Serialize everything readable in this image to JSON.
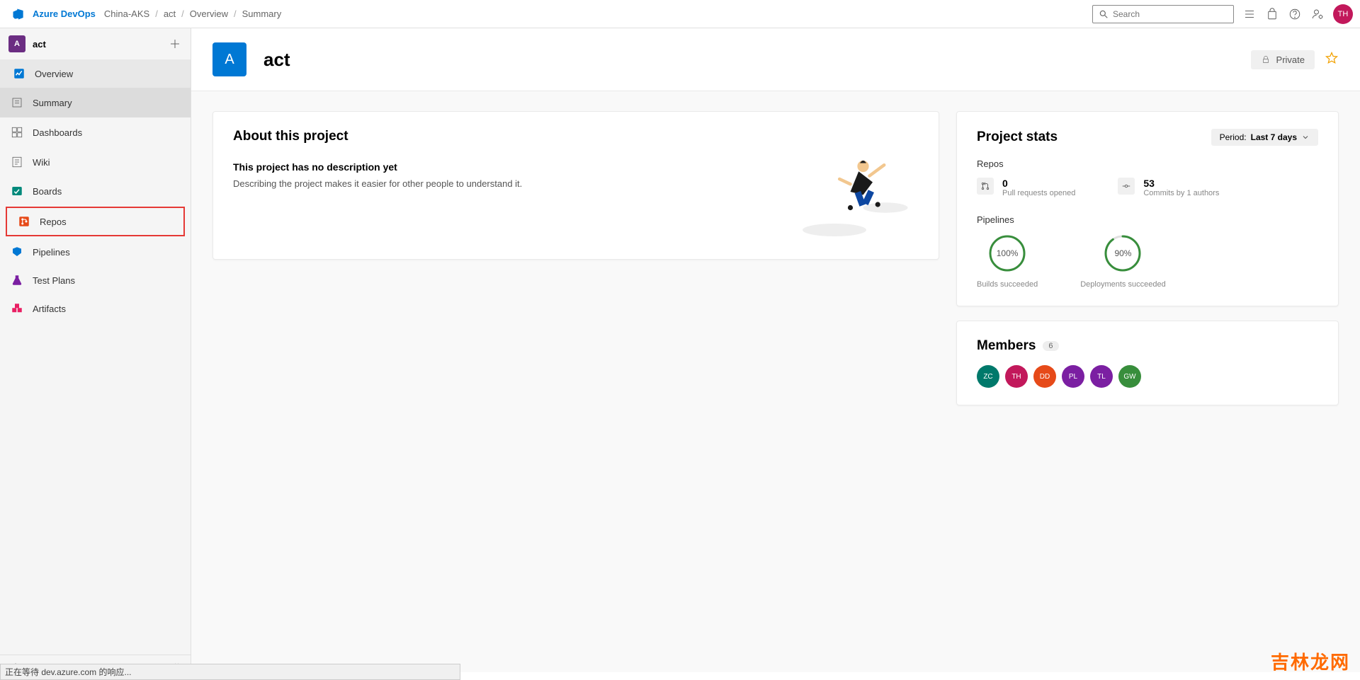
{
  "header": {
    "brand": "Azure DevOps",
    "breadcrumb": [
      "China-AKS",
      "act",
      "Overview",
      "Summary"
    ],
    "search_placeholder": "Search",
    "user_initials": "TH"
  },
  "sidebar": {
    "project_initial": "A",
    "project_name": "act",
    "items": [
      {
        "label": "Overview",
        "icon": "overview",
        "selected": true
      },
      {
        "label": "Summary",
        "icon": "summary",
        "sub": true,
        "active": true
      },
      {
        "label": "Dashboards",
        "icon": "dashboard",
        "sub": true
      },
      {
        "label": "Wiki",
        "icon": "wiki",
        "sub": true
      },
      {
        "label": "Boards",
        "icon": "boards"
      },
      {
        "label": "Repos",
        "icon": "repos",
        "highlighted": true
      },
      {
        "label": "Pipelines",
        "icon": "pipelines"
      },
      {
        "label": "Test Plans",
        "icon": "testplans"
      },
      {
        "label": "Artifacts",
        "icon": "artifacts"
      }
    ],
    "footer": "Project settings"
  },
  "content": {
    "project_initial": "A",
    "project_name": "act",
    "visibility": "Private",
    "about": {
      "title": "About this project",
      "subtitle": "This project has no description yet",
      "description": "Describing the project makes it easier for other people to understand it."
    },
    "stats": {
      "title": "Project stats",
      "period_label": "Period:",
      "period_value": "Last 7 days",
      "repos_label": "Repos",
      "pull_requests": {
        "value": "0",
        "label": "Pull requests opened"
      },
      "commits": {
        "value": "53",
        "label": "Commits by 1 authors"
      },
      "pipelines_label": "Pipelines",
      "builds": {
        "value": "100%",
        "label": "Builds succeeded",
        "percent": 100
      },
      "deployments": {
        "value": "90%",
        "label": "Deployments succeeded",
        "percent": 90
      }
    },
    "members": {
      "title": "Members",
      "count": "6",
      "list": [
        {
          "initials": "ZC",
          "color": "#00796b"
        },
        {
          "initials": "TH",
          "color": "#c2185b"
        },
        {
          "initials": "DD",
          "color": "#e64a19"
        },
        {
          "initials": "PL",
          "color": "#7b1fa2"
        },
        {
          "initials": "TL",
          "color": "#7b1fa2"
        },
        {
          "initials": "GW",
          "color": "#388e3c"
        }
      ]
    }
  },
  "status_bar": "正在等待 dev.azure.com 的响应...",
  "watermark": "吉林龙网"
}
